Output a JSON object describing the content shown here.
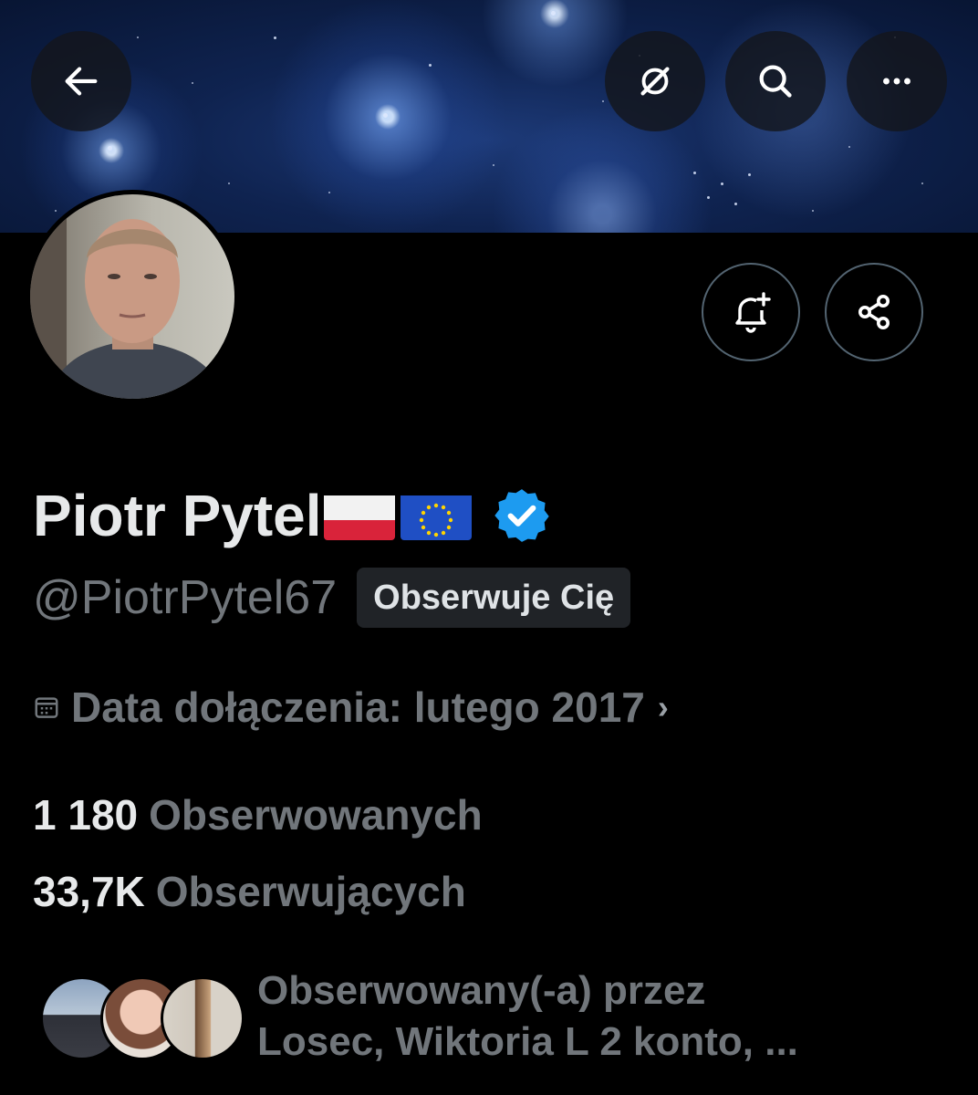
{
  "profile": {
    "name": "Piotr Pytel",
    "handle": "@PiotrPytel67",
    "follows_you_badge": "Obserwuje Cię",
    "joined": "Data dołączenia: lutego 2017",
    "following_count": "1 180",
    "following_label": "Obserwowanych",
    "followers_count": "33,7K",
    "followers_label": "Obserwujących",
    "followed_by_line1": "Obserwowany(-a) przez",
    "followed_by_line2": "Losec, Wiktoria L 2 konto, ..."
  },
  "icons": {
    "back": "arrow-left-icon",
    "grok": "grok-icon",
    "search": "search-icon",
    "more": "more-icon",
    "notify": "bell-plus-icon",
    "share": "share-icon",
    "verified": "verified-badge-icon",
    "calendar": "calendar-icon"
  },
  "colors": {
    "background": "#000000",
    "primary_text": "#e7e9ea",
    "secondary_text": "#71767b",
    "verified_blue": "#1d9bf0",
    "badge_bg": "#202327"
  }
}
